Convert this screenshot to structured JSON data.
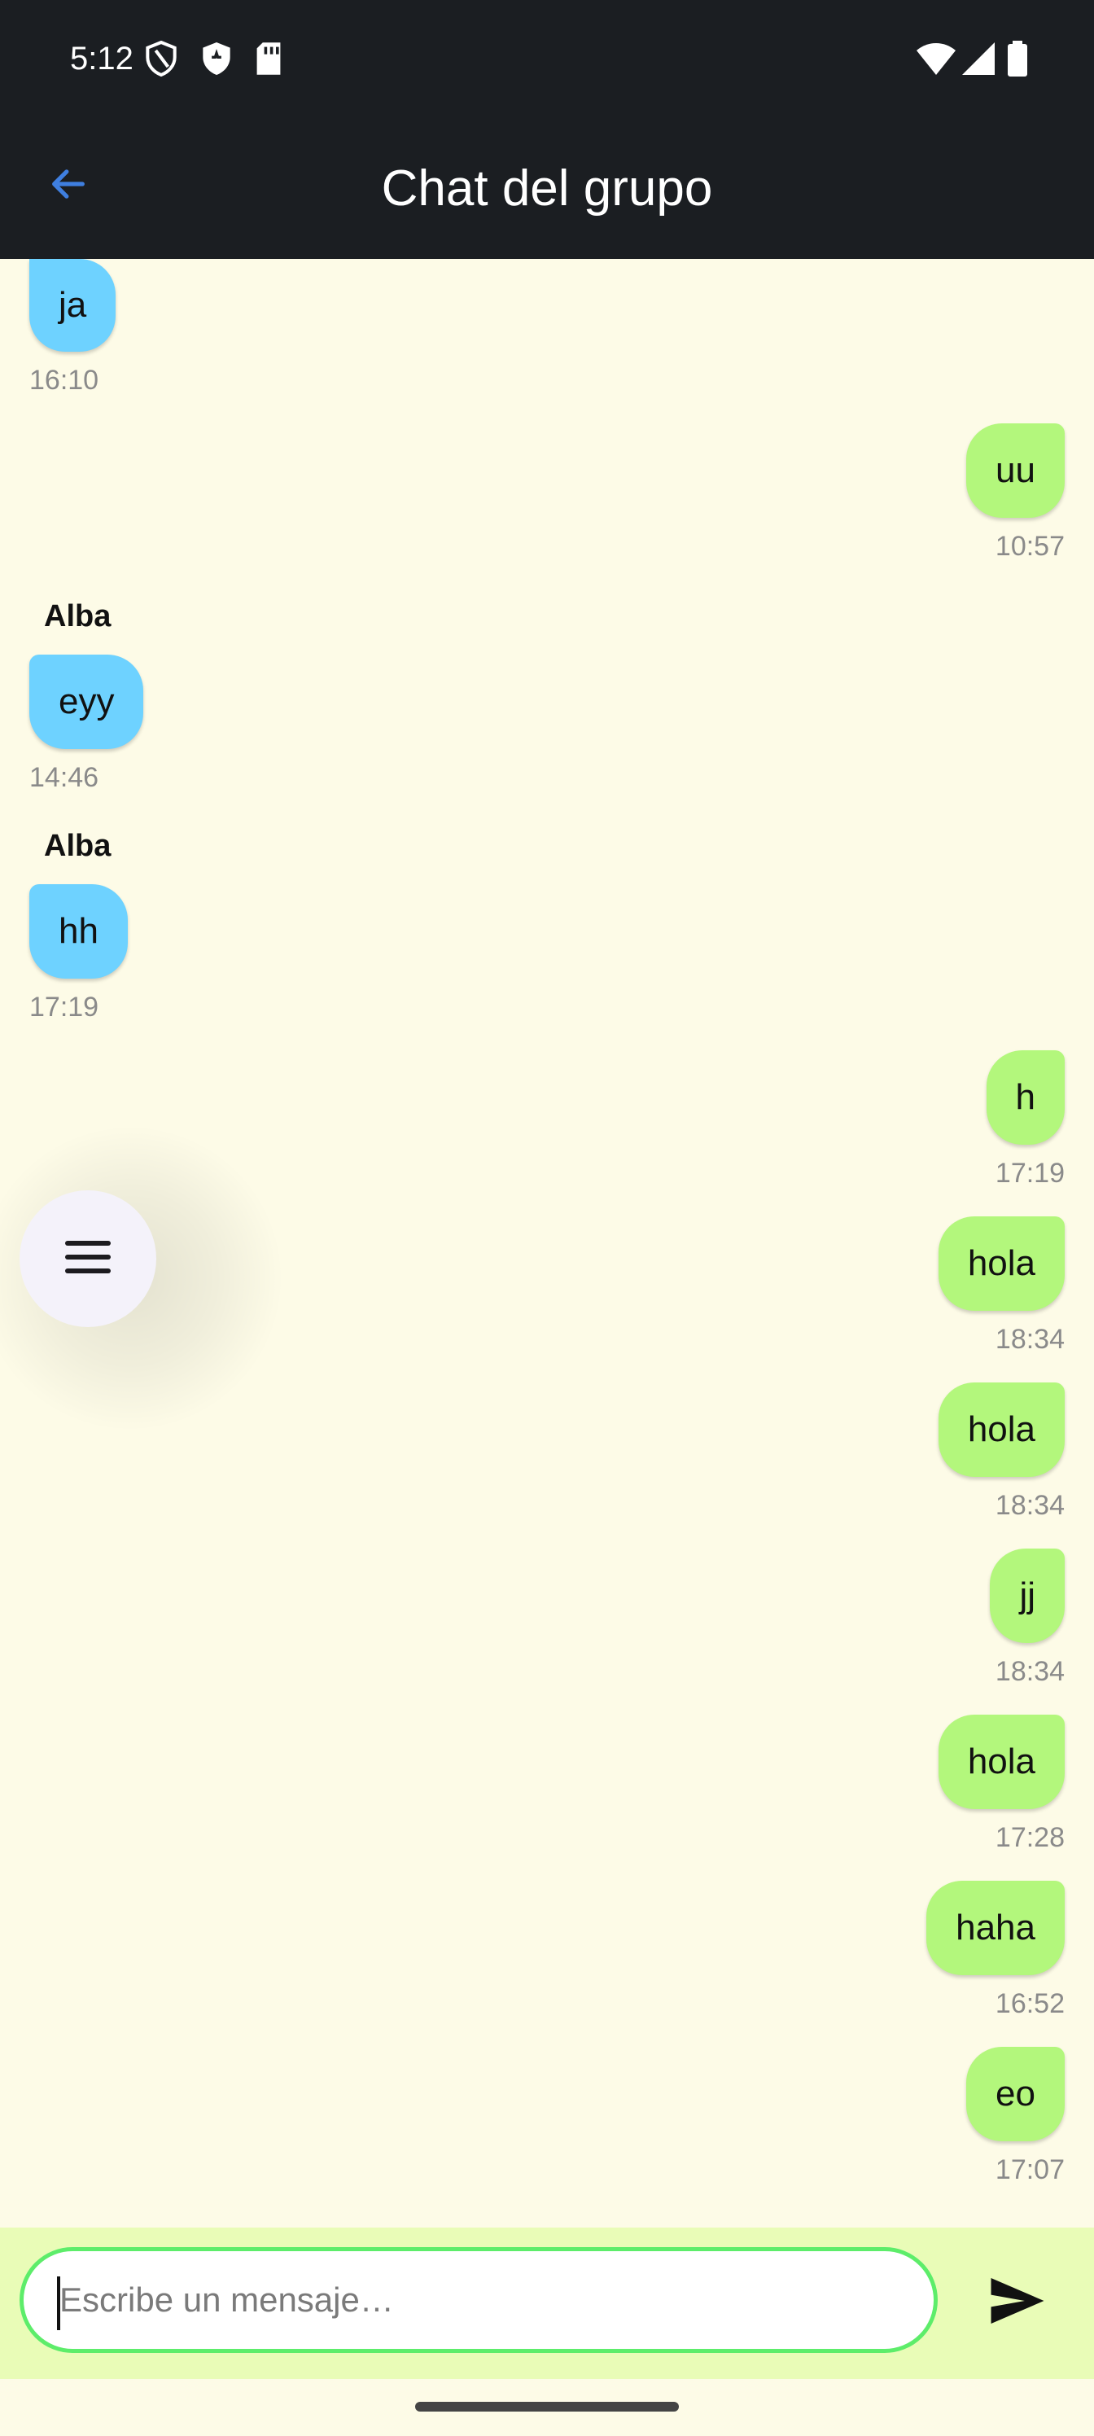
{
  "status_bar": {
    "time": "5:12"
  },
  "app_bar": {
    "title": "Chat del grupo"
  },
  "messages": [
    {
      "direction": "in",
      "sender": "",
      "text": "ja",
      "time": "16:10"
    },
    {
      "direction": "out",
      "sender": "",
      "text": "uu",
      "time": "10:57"
    },
    {
      "direction": "in",
      "sender": "Alba",
      "text": "eyy",
      "time": "14:46"
    },
    {
      "direction": "in",
      "sender": "Alba",
      "text": "hh",
      "time": "17:19"
    },
    {
      "direction": "out",
      "sender": "",
      "text": "h",
      "time": "17:19"
    },
    {
      "direction": "out",
      "sender": "",
      "text": "hola",
      "time": "18:34"
    },
    {
      "direction": "out",
      "sender": "",
      "text": "hola",
      "time": "18:34"
    },
    {
      "direction": "out",
      "sender": "",
      "text": "jj",
      "time": "18:34"
    },
    {
      "direction": "out",
      "sender": "",
      "text": "hola",
      "time": "17:28"
    },
    {
      "direction": "out",
      "sender": "",
      "text": "haha",
      "time": "16:52"
    },
    {
      "direction": "out",
      "sender": "",
      "text": "eo",
      "time": "17:07"
    }
  ],
  "composer": {
    "placeholder": "Escribe un mensaje…",
    "value": ""
  },
  "colors": {
    "incoming_bubble": "#6ed2ff",
    "outgoing_bubble": "#b3f77c",
    "background": "#fdfbe7",
    "input_border": "#5ded6a",
    "back_arrow": "#3f7fe0"
  },
  "icons": {
    "back": "arrow-left-icon",
    "menu": "hamburger-menu-icon",
    "send": "send-icon"
  }
}
